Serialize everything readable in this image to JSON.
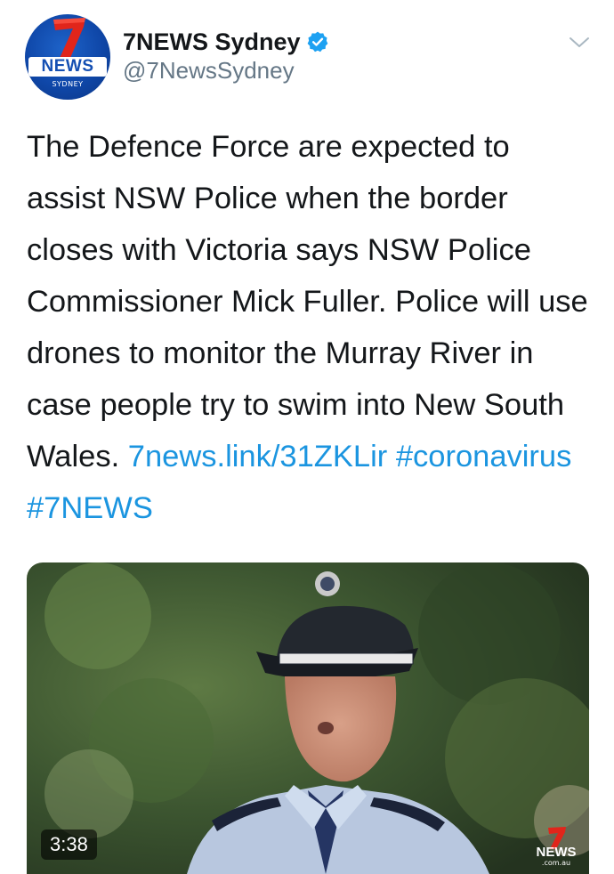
{
  "account": {
    "display_name": "7NEWS Sydney",
    "handle": "@7NewsSydney",
    "verified": true,
    "avatar": {
      "brand": "NEWS",
      "city": "SYDNEY"
    }
  },
  "menu_icon": "chevron-down-icon",
  "tweet": {
    "text": "The Defence Force are expected to assist NSW Police when the border closes with Victoria says NSW Police Commissioner Mick Fuller. Police will use drones to monitor the Murray River in case people try to swim into New South Wales.",
    "link": "7news.link/31ZKLir",
    "hashtag_1": "#coronavirus",
    "hashtag_2": "#7NEWS"
  },
  "media": {
    "type": "video",
    "duration": "3:38",
    "watermark": "NEWS",
    "watermark_sub": ".com.au"
  },
  "colors": {
    "link": "#1b95e0",
    "verified": "#1da1f2",
    "text": "#14171a",
    "secondary": "#657786",
    "brand_blue": "#1550b3",
    "brand_red": "#e1251b"
  }
}
